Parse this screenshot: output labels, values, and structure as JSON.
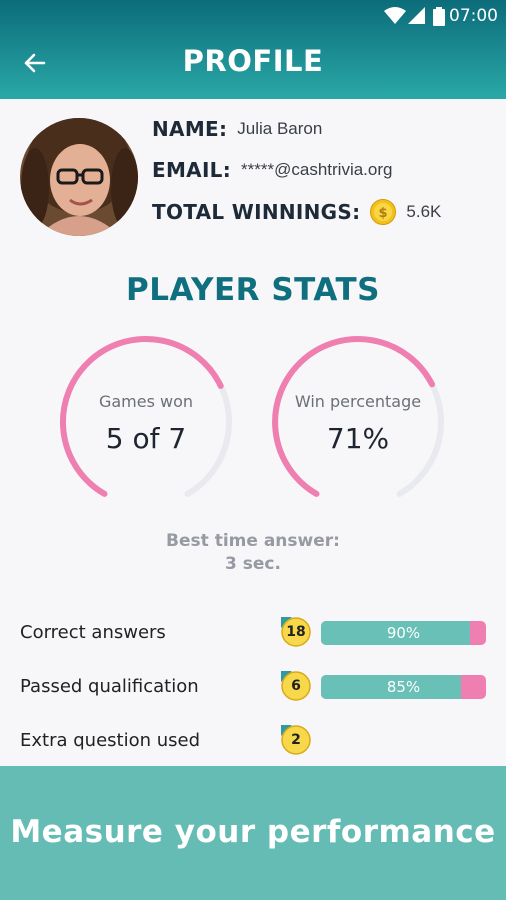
{
  "status_bar": {
    "time": "07:00"
  },
  "app_bar": {
    "title": "PROFILE"
  },
  "profile": {
    "name_label": "NAME:",
    "name": "Julia Baron",
    "email_label": "EMAIL:",
    "email": "*****@cashtrivia.org",
    "winnings_label": "TOTAL WINNINGS:",
    "winnings": "5.6K"
  },
  "stats": {
    "title": "PLAYER STATS",
    "gauges": [
      {
        "label": "Games won",
        "value": "5 of 7",
        "fraction": 0.714
      },
      {
        "label": "Win percentage",
        "value": "71%",
        "fraction": 0.71
      }
    ],
    "best_time_label": "Best time answer:",
    "best_time_value": "3 sec.",
    "rows": [
      {
        "label": "Correct answers",
        "count": "18",
        "percent_text": "90%",
        "percent": 90
      },
      {
        "label": "Passed qualification",
        "count": "6",
        "percent_text": "85%",
        "percent": 85
      },
      {
        "label": "Extra question used",
        "count": "2"
      }
    ]
  },
  "footer": {
    "text": "Measure your performance"
  },
  "colors": {
    "accent_pink": "#ef7fb0",
    "teal": "#68c0b6",
    "title_teal": "#0f6f7e",
    "coin": "#f2c21a"
  }
}
